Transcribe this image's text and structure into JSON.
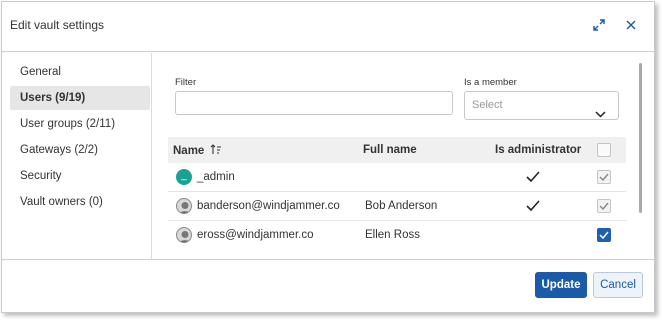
{
  "dialog": {
    "title": "Edit vault settings"
  },
  "sidebar": {
    "items": [
      {
        "label": "General",
        "active": false
      },
      {
        "label": "Users (9/19)",
        "active": true
      },
      {
        "label": "User groups (2/11)",
        "active": false
      },
      {
        "label": "Gateways (2/2)",
        "active": false
      },
      {
        "label": "Security",
        "active": false
      },
      {
        "label": "Vault owners (0)",
        "active": false
      }
    ]
  },
  "filter": {
    "label": "Filter",
    "value": "",
    "placeholder": ""
  },
  "member_filter": {
    "label": "Is a member",
    "selected": "Select"
  },
  "table": {
    "columns": {
      "name": "Name",
      "full_name": "Full name",
      "is_admin": "Is administrator"
    },
    "sort_icon": "sort-ascending-icon",
    "rows": [
      {
        "avatar": "_",
        "name": "_admin",
        "full_name": "",
        "is_admin": true,
        "member": true,
        "member_editable": false
      },
      {
        "avatar": "photo",
        "name": "banderson@windjammer.co",
        "full_name": "Bob Anderson",
        "is_admin": true,
        "member": true,
        "member_editable": false
      },
      {
        "avatar": "photo",
        "name": "eross@windjammer.co",
        "full_name": "Ellen Ross",
        "is_admin": false,
        "member": true,
        "member_editable": true
      }
    ]
  },
  "footer": {
    "update_label": "Update",
    "cancel_label": "Cancel"
  },
  "colors": {
    "primary": "#1b5aa8",
    "avatar_teal": "#1aa393",
    "checkbox_blue": "#1f5fb0"
  }
}
